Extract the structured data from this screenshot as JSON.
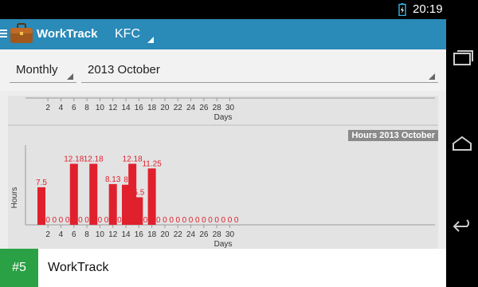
{
  "status": {
    "time": "20:19"
  },
  "app": {
    "title": "WorkTrack",
    "company": "KFC"
  },
  "filters": {
    "period": "Monthly",
    "month": "2013 October"
  },
  "banner": {
    "rank": "#5",
    "title": "WorkTrack"
  },
  "colors": {
    "action_bar": "#2a8ab8",
    "bar": "#e0202d",
    "badge": "#2aa144"
  },
  "chart_data": [
    {
      "type": "bar",
      "x_tick_labels": [
        "2",
        "4",
        "6",
        "8",
        "10",
        "12",
        "14",
        "16",
        "18",
        "20",
        "22",
        "24",
        "26",
        "28",
        "30"
      ],
      "xlabel": "Days",
      "ylabel": "",
      "title": ""
    },
    {
      "type": "bar",
      "title": "Hours 2013 October",
      "xlabel": "Days",
      "ylabel": "Hours",
      "categories": [
        1,
        2,
        3,
        4,
        5,
        6,
        7,
        8,
        9,
        10,
        11,
        12,
        13,
        14,
        15,
        16,
        17,
        18,
        19,
        20,
        21,
        22,
        23,
        24,
        25,
        26,
        27,
        28,
        29,
        30,
        31
      ],
      "values": [
        7.5,
        0,
        0,
        0,
        0,
        12.18,
        0,
        0,
        12.18,
        0,
        0,
        8.13,
        0,
        8,
        12.18,
        5.5,
        0,
        11.25,
        0,
        0,
        0,
        0,
        0,
        0,
        0,
        0,
        0,
        0,
        0,
        0,
        0
      ],
      "value_labels": [
        "7.5",
        "0",
        "0",
        "0",
        "0",
        "12.18",
        "0",
        "0",
        "12.18",
        "0",
        "0",
        "8.13",
        "0",
        "8",
        "12.18",
        "5.5",
        "0",
        "11.25",
        "0",
        "0",
        "0",
        "0",
        "0",
        "0",
        "0",
        "0",
        "0",
        "0",
        "0",
        "0",
        "0"
      ],
      "x_tick_labels": [
        "2",
        "4",
        "6",
        "8",
        "10",
        "12",
        "14",
        "16",
        "18",
        "20",
        "22",
        "24",
        "26",
        "28",
        "30"
      ],
      "ylim": [
        0,
        14
      ]
    }
  ]
}
